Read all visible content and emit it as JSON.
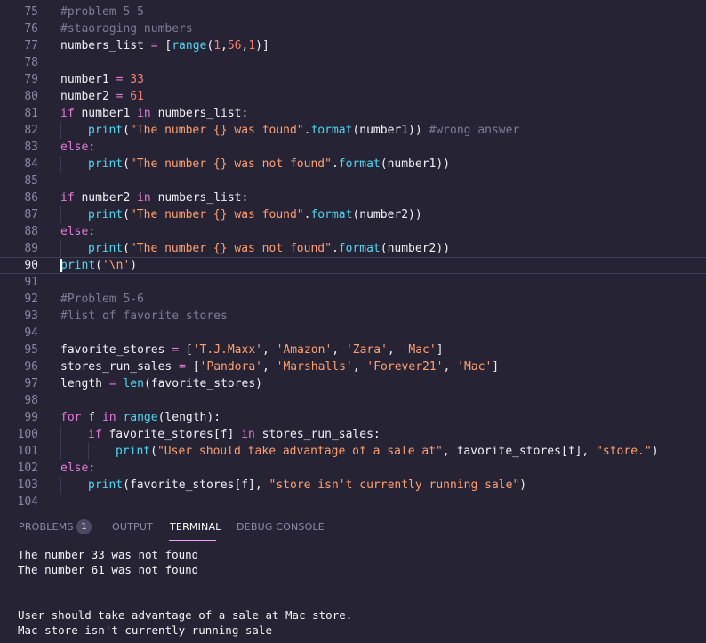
{
  "colors": {
    "background": "#262335",
    "keyword": "#e17bd6",
    "string": "#ff9f6e",
    "comment": "#7f7a93",
    "number": "#f97e72",
    "builtin": "#4dd7f0",
    "accent": "#b45ad2"
  },
  "editor": {
    "lines": [
      {
        "n": "75",
        "tokens": [
          {
            "t": "#problem 5-5",
            "c": "comment"
          }
        ]
      },
      {
        "n": "76",
        "tokens": [
          {
            "t": "#staoraging numbers",
            "c": "comment"
          }
        ]
      },
      {
        "n": "77",
        "tokens": [
          {
            "t": "numbers_list ",
            "c": "plain"
          },
          {
            "t": "=",
            "c": "keyword"
          },
          {
            "t": " [",
            "c": "plain"
          },
          {
            "t": "range",
            "c": "builtin"
          },
          {
            "t": "(",
            "c": "plain"
          },
          {
            "t": "1",
            "c": "number"
          },
          {
            "t": ",",
            "c": "plain"
          },
          {
            "t": "56",
            "c": "number"
          },
          {
            "t": ",",
            "c": "plain"
          },
          {
            "t": "1",
            "c": "number"
          },
          {
            "t": ")]",
            "c": "plain"
          }
        ]
      },
      {
        "n": "78",
        "tokens": []
      },
      {
        "n": "79",
        "tokens": [
          {
            "t": "number1 ",
            "c": "plain"
          },
          {
            "t": "=",
            "c": "keyword"
          },
          {
            "t": " ",
            "c": "plain"
          },
          {
            "t": "33",
            "c": "number"
          }
        ]
      },
      {
        "n": "80",
        "tokens": [
          {
            "t": "number2 ",
            "c": "plain"
          },
          {
            "t": "=",
            "c": "keyword"
          },
          {
            "t": " ",
            "c": "plain"
          },
          {
            "t": "61",
            "c": "number"
          }
        ]
      },
      {
        "n": "81",
        "tokens": [
          {
            "t": "if",
            "c": "keyword"
          },
          {
            "t": " number1 ",
            "c": "plain"
          },
          {
            "t": "in",
            "c": "keyword"
          },
          {
            "t": " numbers_list:",
            "c": "plain"
          }
        ]
      },
      {
        "n": "82",
        "indent": 1,
        "tokens": [
          {
            "t": "print",
            "c": "builtin"
          },
          {
            "t": "(",
            "c": "plain"
          },
          {
            "t": "\"The number {} was found\"",
            "c": "string"
          },
          {
            "t": ".",
            "c": "plain"
          },
          {
            "t": "format",
            "c": "builtin"
          },
          {
            "t": "(number1)) ",
            "c": "plain"
          },
          {
            "t": "#wrong answer",
            "c": "comment"
          }
        ]
      },
      {
        "n": "83",
        "tokens": [
          {
            "t": "else",
            "c": "keyword"
          },
          {
            "t": ":",
            "c": "plain"
          }
        ]
      },
      {
        "n": "84",
        "indent": 1,
        "tokens": [
          {
            "t": "print",
            "c": "builtin"
          },
          {
            "t": "(",
            "c": "plain"
          },
          {
            "t": "\"The number {} was not found\"",
            "c": "string"
          },
          {
            "t": ".",
            "c": "plain"
          },
          {
            "t": "format",
            "c": "builtin"
          },
          {
            "t": "(number1))",
            "c": "plain"
          }
        ]
      },
      {
        "n": "85",
        "tokens": []
      },
      {
        "n": "86",
        "tokens": [
          {
            "t": "if",
            "c": "keyword"
          },
          {
            "t": " number2 ",
            "c": "plain"
          },
          {
            "t": "in",
            "c": "keyword"
          },
          {
            "t": " numbers_list:",
            "c": "plain"
          }
        ]
      },
      {
        "n": "87",
        "indent": 1,
        "tokens": [
          {
            "t": "print",
            "c": "builtin"
          },
          {
            "t": "(",
            "c": "plain"
          },
          {
            "t": "\"The number {} was found\"",
            "c": "string"
          },
          {
            "t": ".",
            "c": "plain"
          },
          {
            "t": "format",
            "c": "builtin"
          },
          {
            "t": "(number2))",
            "c": "plain"
          }
        ]
      },
      {
        "n": "88",
        "tokens": [
          {
            "t": "else",
            "c": "keyword"
          },
          {
            "t": ":",
            "c": "plain"
          }
        ]
      },
      {
        "n": "89",
        "indent": 1,
        "tokens": [
          {
            "t": "print",
            "c": "builtin"
          },
          {
            "t": "(",
            "c": "plain"
          },
          {
            "t": "\"The number {} was not found\"",
            "c": "string"
          },
          {
            "t": ".",
            "c": "plain"
          },
          {
            "t": "format",
            "c": "builtin"
          },
          {
            "t": "(number2))",
            "c": "plain"
          }
        ]
      },
      {
        "n": "90",
        "current": true,
        "tokens": [
          {
            "t": "print",
            "c": "builtin"
          },
          {
            "t": "(",
            "c": "plain"
          },
          {
            "t": "'\\n'",
            "c": "string"
          },
          {
            "t": ")",
            "c": "plain"
          }
        ]
      },
      {
        "n": "91",
        "tokens": []
      },
      {
        "n": "92",
        "tokens": [
          {
            "t": "#Problem 5-6",
            "c": "comment"
          }
        ]
      },
      {
        "n": "93",
        "tokens": [
          {
            "t": "#list of favorite stores",
            "c": "comment"
          }
        ]
      },
      {
        "n": "94",
        "tokens": []
      },
      {
        "n": "95",
        "tokens": [
          {
            "t": "favorite_stores ",
            "c": "plain"
          },
          {
            "t": "=",
            "c": "keyword"
          },
          {
            "t": " [",
            "c": "plain"
          },
          {
            "t": "'T.J.Maxx'",
            "c": "string"
          },
          {
            "t": ", ",
            "c": "plain"
          },
          {
            "t": "'Amazon'",
            "c": "string"
          },
          {
            "t": ", ",
            "c": "plain"
          },
          {
            "t": "'Zara'",
            "c": "string"
          },
          {
            "t": ", ",
            "c": "plain"
          },
          {
            "t": "'Mac'",
            "c": "string"
          },
          {
            "t": "]",
            "c": "plain"
          }
        ]
      },
      {
        "n": "96",
        "tokens": [
          {
            "t": "stores_run_sales ",
            "c": "plain"
          },
          {
            "t": "=",
            "c": "keyword"
          },
          {
            "t": " [",
            "c": "plain"
          },
          {
            "t": "'Pandora'",
            "c": "string"
          },
          {
            "t": ", ",
            "c": "plain"
          },
          {
            "t": "'Marshalls'",
            "c": "string"
          },
          {
            "t": ", ",
            "c": "plain"
          },
          {
            "t": "'Forever21'",
            "c": "string"
          },
          {
            "t": ", ",
            "c": "plain"
          },
          {
            "t": "'Mac'",
            "c": "string"
          },
          {
            "t": "]",
            "c": "plain"
          }
        ]
      },
      {
        "n": "97",
        "tokens": [
          {
            "t": "length ",
            "c": "plain"
          },
          {
            "t": "=",
            "c": "keyword"
          },
          {
            "t": " ",
            "c": "plain"
          },
          {
            "t": "len",
            "c": "builtin"
          },
          {
            "t": "(favorite_stores)",
            "c": "plain"
          }
        ]
      },
      {
        "n": "98",
        "tokens": []
      },
      {
        "n": "99",
        "tokens": [
          {
            "t": "for",
            "c": "keyword"
          },
          {
            "t": " f ",
            "c": "plain"
          },
          {
            "t": "in",
            "c": "keyword"
          },
          {
            "t": " ",
            "c": "plain"
          },
          {
            "t": "range",
            "c": "builtin"
          },
          {
            "t": "(length):",
            "c": "plain"
          }
        ]
      },
      {
        "n": "100",
        "indent": 1,
        "tokens": [
          {
            "t": "if",
            "c": "keyword"
          },
          {
            "t": " favorite_stores[f] ",
            "c": "plain"
          },
          {
            "t": "in",
            "c": "keyword"
          },
          {
            "t": " stores_run_sales:",
            "c": "plain"
          }
        ]
      },
      {
        "n": "101",
        "indent": 2,
        "tokens": [
          {
            "t": "print",
            "c": "builtin"
          },
          {
            "t": "(",
            "c": "plain"
          },
          {
            "t": "\"User should take advantage of a sale at\"",
            "c": "string"
          },
          {
            "t": ", favorite_stores[f], ",
            "c": "plain"
          },
          {
            "t": "\"store.\"",
            "c": "string"
          },
          {
            "t": ")",
            "c": "plain"
          }
        ]
      },
      {
        "n": "102",
        "tokens": [
          {
            "t": "else",
            "c": "keyword"
          },
          {
            "t": ":",
            "c": "plain"
          }
        ]
      },
      {
        "n": "103",
        "indent": 1,
        "tokens": [
          {
            "t": "print",
            "c": "builtin"
          },
          {
            "t": "(favorite_stores[f], ",
            "c": "plain"
          },
          {
            "t": "\"store isn't currently running sale\"",
            "c": "string"
          },
          {
            "t": ")",
            "c": "plain"
          }
        ]
      },
      {
        "n": "104",
        "tokens": []
      }
    ]
  },
  "panel": {
    "tabs": [
      {
        "label": "PROBLEMS",
        "active": false
      },
      {
        "label": "OUTPUT",
        "active": false
      },
      {
        "label": "TERMINAL",
        "active": true
      },
      {
        "label": "DEBUG CONSOLE",
        "active": false
      }
    ],
    "problems_count": "1",
    "terminal_lines": [
      "The number 33 was not found",
      "The number 61 was not found",
      "",
      "",
      "User should take advantage of a sale at Mac store.",
      "Mac store isn't currently running sale"
    ]
  }
}
